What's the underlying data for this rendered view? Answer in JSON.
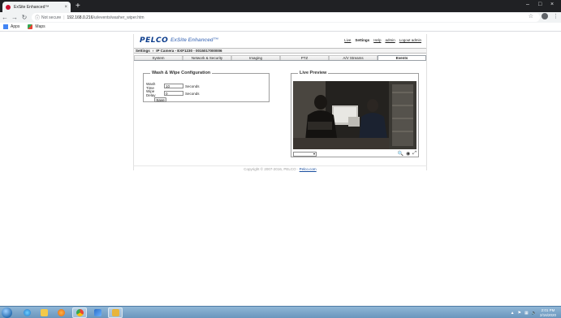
{
  "browser": {
    "tab_title": "ExSite Enhanced™",
    "tab_close": "×",
    "new_tab": "+",
    "window_controls": [
      "–",
      "□",
      "×"
    ],
    "security_label": "Not secure",
    "url_host": "192.168.0.216",
    "url_path": "/ui/events/washer_wiper.htm",
    "bookmarks": [
      {
        "label": "Apps",
        "icon": "apps-grid-icon"
      },
      {
        "label": "Maps",
        "icon": "maps-icon"
      }
    ]
  },
  "header": {
    "logo": "PELCO",
    "product": "ExSite Enhanced™",
    "links": [
      {
        "label": "Live",
        "active": false
      },
      {
        "label": "Settings",
        "active": true
      },
      {
        "label": "Help",
        "active": false
      },
      {
        "label": "admin",
        "active": false
      },
      {
        "label": "Logout admin",
        "active": false
      }
    ]
  },
  "breadcrumb": {
    "section": "Settings",
    "separator": "›",
    "device": "IP Camera - EXF1230 - 0015017000006"
  },
  "tabs": [
    {
      "label": "System",
      "active": false
    },
    {
      "label": "Network & Security",
      "active": false
    },
    {
      "label": "Imaging",
      "active": false
    },
    {
      "label": "PTZ",
      "active": false
    },
    {
      "label": "A/V Streams",
      "active": false
    },
    {
      "label": "Events",
      "active": true
    }
  ],
  "wash_wipe": {
    "title": "Wash & Wipe Configuration",
    "wash_time_label": "Wash Time",
    "wash_time_value": "10",
    "wash_time_unit": "Seconds",
    "wipe_delay_label": "Wipe Delay",
    "wipe_delay_value": "0",
    "wipe_delay_unit": "Seconds",
    "save_label": "Save"
  },
  "live_preview": {
    "title": "Live Preview",
    "stream_select_value": "",
    "controls": [
      "zoom-in-icon",
      "snapshot-icon",
      "fullscreen-icon"
    ]
  },
  "footer": {
    "copyright": "Copyright © 2007-2016, PELCO ·",
    "link": "Pelco.com"
  },
  "taskbar": {
    "apps": [
      "start-orb",
      "ie-icon",
      "explorer-icon",
      "media-player-icon",
      "chrome-icon",
      "virtualbox-icon",
      "file-manager-icon"
    ],
    "time": "2:01 PM",
    "date": "2/16/2020"
  },
  "colors": {
    "brand_blue": "#0b3c8c",
    "taskbar": "#6a96bd"
  }
}
